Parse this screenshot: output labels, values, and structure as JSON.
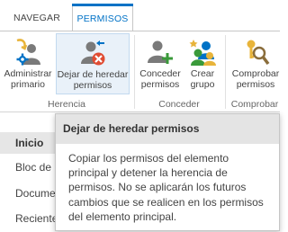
{
  "tabs": [
    {
      "label": "NAVEGAR"
    },
    {
      "label": "PERMISOS"
    }
  ],
  "ribbon": {
    "groups": [
      {
        "label": "Herencia"
      },
      {
        "label": "Conceder"
      },
      {
        "label": "Comprobar"
      }
    ],
    "buttons": [
      {
        "line1": "Administrar",
        "line2": "primario",
        "icon": "manage-parent-icon"
      },
      {
        "line1": "Dejar de heredar",
        "line2": "permisos",
        "icon": "stop-inheriting-icon"
      },
      {
        "line1": "Conceder",
        "line2": "permisos",
        "icon": "grant-permissions-icon"
      },
      {
        "line1": "Crear",
        "line2": "grupo",
        "icon": "create-group-icon"
      },
      {
        "line1": "Comprobar",
        "line2": "permisos",
        "icon": "check-permissions-icon"
      }
    ]
  },
  "quick_launch": [
    {
      "label": "Inicio"
    },
    {
      "label": "Bloc de"
    },
    {
      "label": "Docume"
    },
    {
      "label": "Reciente"
    }
  ],
  "partial_link": "ivaliviiiviiiv",
  "tooltip": {
    "title": "Dejar de heredar permisos",
    "body": "Copiar los permisos del elemento principal y detener la herencia de permisos. No se aplicarán los futuros cambios que se realicen en los permisos del elemento principal."
  },
  "colors": {
    "accent": "#0072c6",
    "stop_badge": "#e04c33",
    "key_gold": "#e8b43a",
    "magnifier": "#8a6d3b"
  }
}
